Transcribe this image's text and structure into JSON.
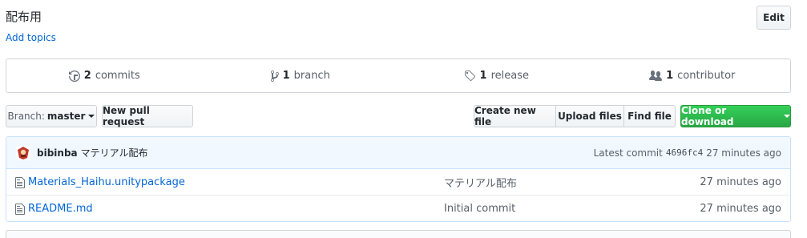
{
  "repo": {
    "description": "配布用",
    "add_topics": "Add topics",
    "edit_label": "Edit"
  },
  "summary": {
    "commits": {
      "count": "2",
      "label": "commits"
    },
    "branches": {
      "count": "1",
      "label": "branch"
    },
    "releases": {
      "count": "1",
      "label": "release"
    },
    "contributors": {
      "count": "1",
      "label": "contributor"
    }
  },
  "toolbar": {
    "branch_label": "Branch:",
    "branch_value": "master",
    "pull_request": "New pull request",
    "create_file": "Create new file",
    "upload_files": "Upload files",
    "find_file": "Find file",
    "clone": "Clone or download"
  },
  "latest_commit": {
    "author": "bibinba",
    "message": "マテリアル配布",
    "prefix": "Latest commit",
    "sha": "4696fc4",
    "age": "27 minutes ago"
  },
  "files": [
    {
      "name": "Materials_Haihu.unitypackage",
      "message": "マテリアル配布",
      "age": "27 minutes ago"
    },
    {
      "name": "README.md",
      "message": "Initial commit",
      "age": "27 minutes ago"
    }
  ],
  "colors": {
    "link": "#0366d6",
    "clone_green": "#28a745",
    "commit_bar": "#f1f8ff"
  }
}
